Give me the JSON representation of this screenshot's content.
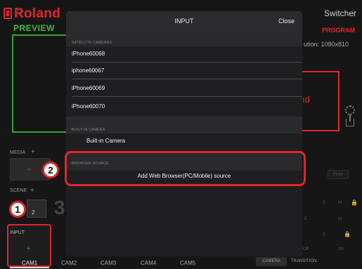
{
  "app": {
    "brand": "Roland",
    "title": "Switcher",
    "preview_label": "PREVIEW",
    "program_label": "PROGRAM",
    "resolution_text": "ution: 1080x810",
    "program_fragment": "ıd"
  },
  "left_panels": {
    "media_label": "MEDIA",
    "media_plus": "+",
    "scene_label": "SCENE",
    "scene_plus": "+",
    "scene_number": "2",
    "scene_big_number": "3",
    "input_label": "INPUT",
    "input_plus": "+"
  },
  "cam_tabs": [
    "CAM1",
    "CAM2",
    "CAM3",
    "CAM4",
    "CAM5"
  ],
  "mode_tabs": {
    "camera": "CAMERA",
    "transition": "TRANSITION"
  },
  "right_controls": {
    "front": "Front",
    "letters": [
      "C",
      "M",
      "E",
      "M",
      "C"
    ],
    "off": "Off",
    "on": "On",
    "lock_icon": "lock-icon"
  },
  "modal": {
    "title": "INPUT",
    "close_label": "Close",
    "satellite_section": "SATELLITE CAMERAS",
    "satellite_cameras": [
      "iPhone60068",
      "iphone60067",
      "iPhone60069",
      "iPhone60070"
    ],
    "builtin_section": "BUILT-IN CAMERA",
    "builtin_camera": "Built-in Camera",
    "browser_section": "BROWSER SOURCE",
    "browser_action": "Add Web Browser(PC/Mobile) source"
  },
  "callouts": {
    "badge_1": "1",
    "badge_2": "2"
  },
  "colors": {
    "accent_red": "#e0262c",
    "preview_green": "#3fbb3f",
    "modal_bg": "#1f1f21"
  }
}
